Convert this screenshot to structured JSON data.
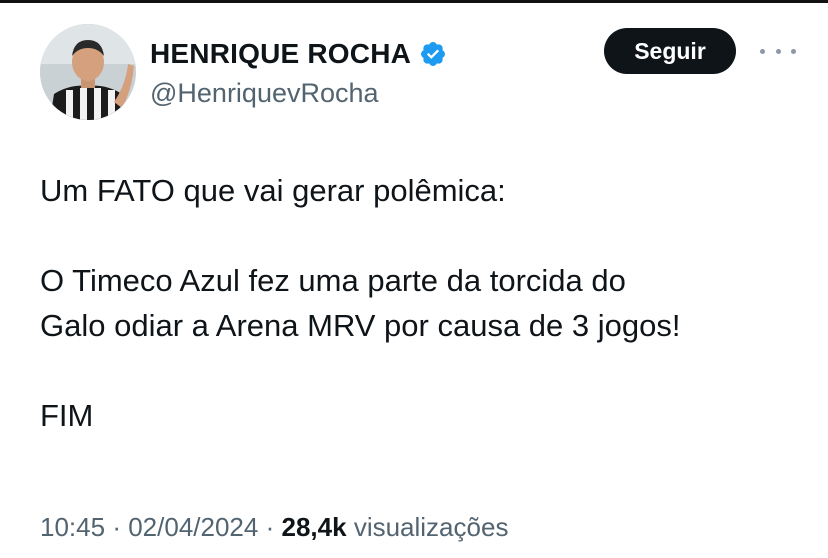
{
  "profile": {
    "display_name": "HENRIQUE ROCHA",
    "handle": "@HenriquevRocha",
    "verified_icon": "verified-badge-icon",
    "verified_color": "#1d9bf0"
  },
  "actions": {
    "follow_label": "Seguir",
    "more_icon": "more-options-icon"
  },
  "tweet": {
    "lines": [
      "Um FATO que vai gerar polêmica:",
      "",
      "O Timeco Azul fez uma parte da torcida do",
      "Galo odiar a Arena MRV por causa de 3 jogos!",
      "",
      "FIM"
    ]
  },
  "meta": {
    "time": "10:45",
    "separator": "·",
    "date": "02/04/2024",
    "views_count": "28,4k",
    "views_label": "visualizações"
  }
}
